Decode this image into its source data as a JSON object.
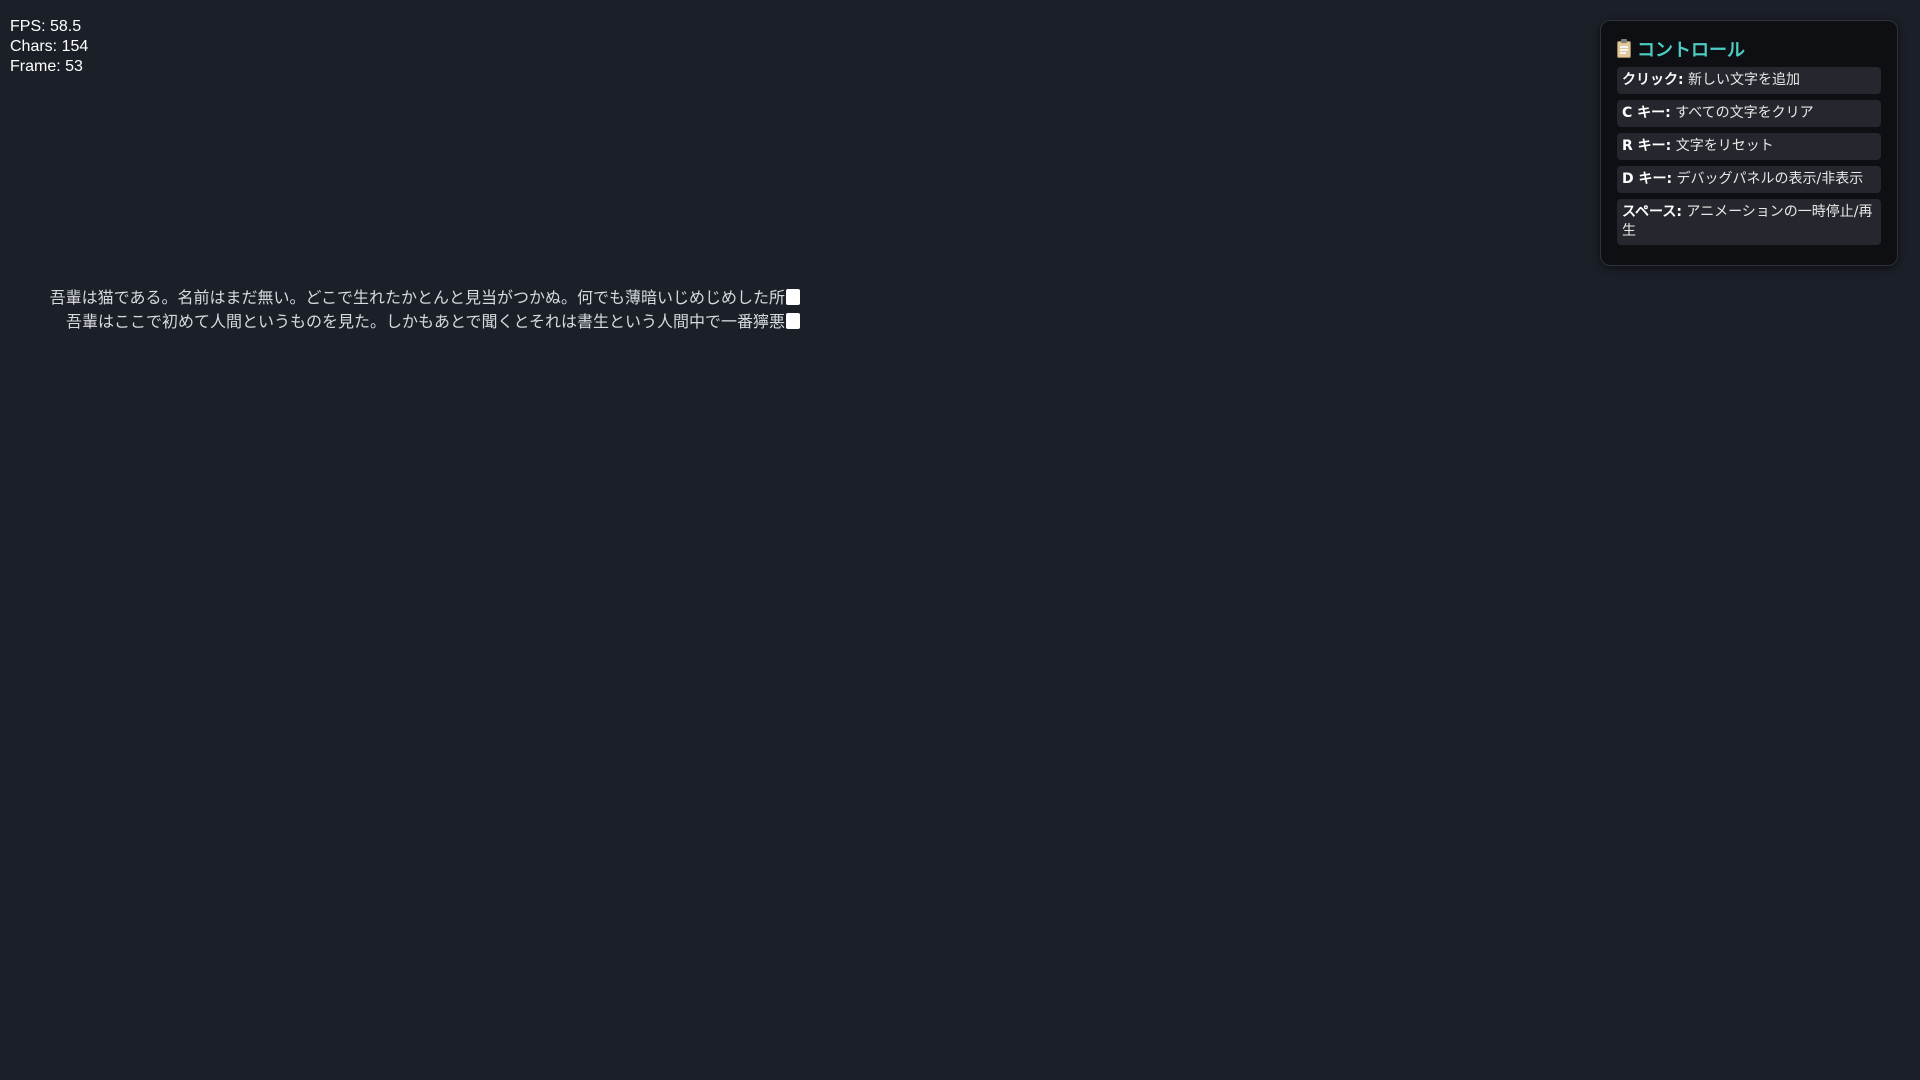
{
  "debug": {
    "fps": "FPS: 58.5",
    "chars": "Chars: 154",
    "frame": "Frame: 53"
  },
  "text_lines": [
    "吾輩は猫である。名前はまだ無い。どこで生れたかとんと見当がつかぬ。何でも薄暗いじめじめした所",
    "吾輩はここで初めて人間というものを見た。しかもあとで聞くとそれは書生という人間中で一番獰悪"
  ],
  "controls": {
    "icon": "clipboard-icon",
    "title": "コントロール",
    "items": [
      {
        "key": "クリック:",
        "desc": " 新しい文字を追加"
      },
      {
        "key": "C キー:",
        "desc": " すべての文字をクリア"
      },
      {
        "key": "R キー:",
        "desc": " 文字をリセット"
      },
      {
        "key": "D キー:",
        "desc": " デバッグパネルの表示/非表示"
      },
      {
        "key": "スペース:",
        "desc": " アニメーションの一時停止/再生"
      }
    ]
  },
  "colors": {
    "background": "#1b1f27",
    "accent": "#4ecdc4",
    "panel": "#0d0f13",
    "item": "#24272d"
  }
}
